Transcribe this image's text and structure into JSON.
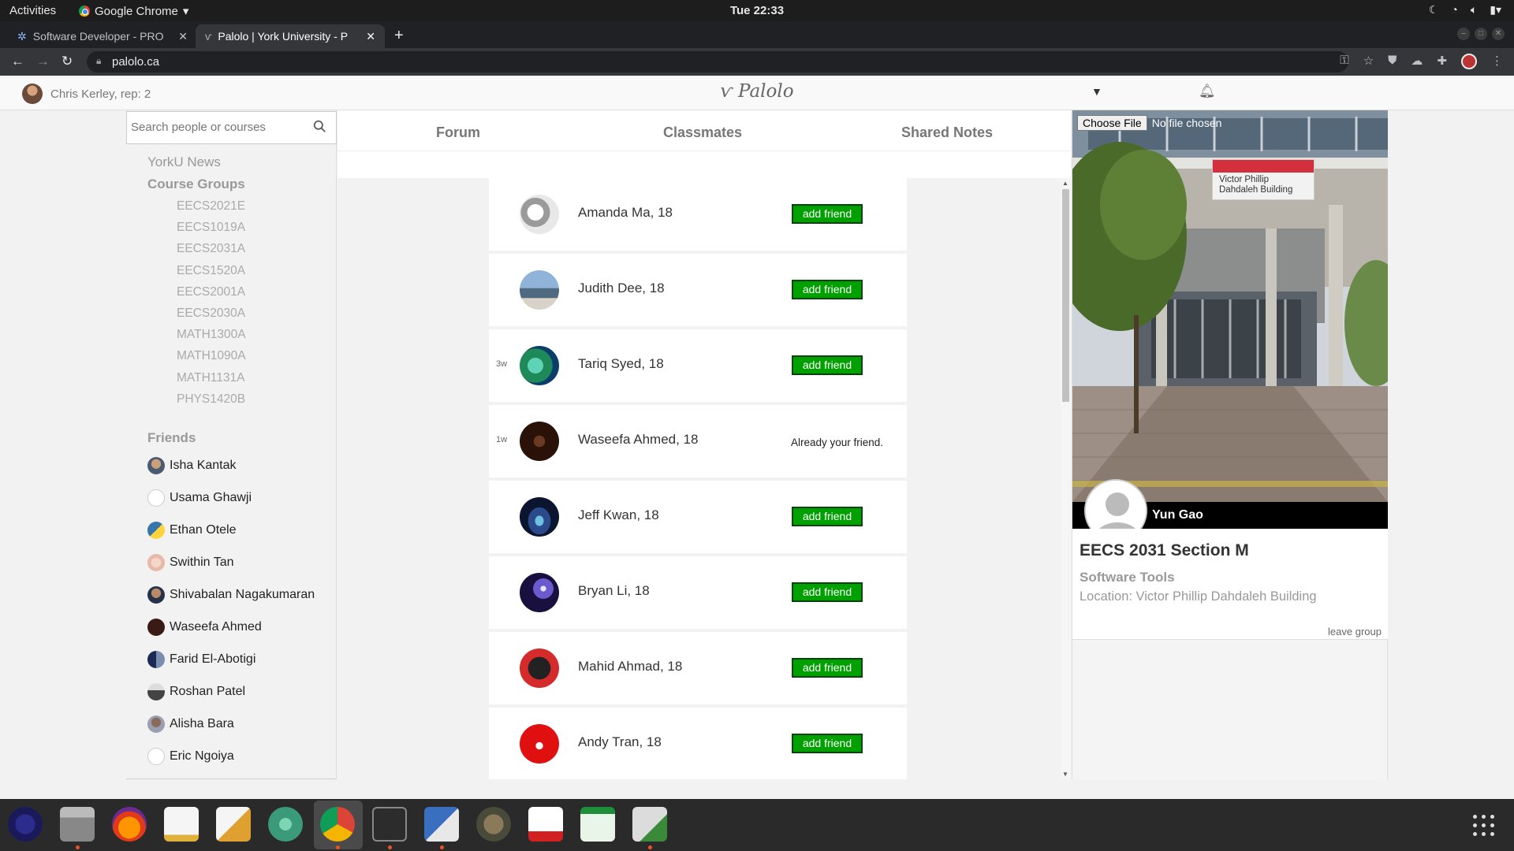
{
  "system": {
    "activities": "Activities",
    "app_name": "Google Chrome",
    "clock": "Tue 22:33"
  },
  "browser": {
    "tabs": [
      {
        "title": "Software Developer - PRO",
        "active": false
      },
      {
        "title": "Palolo | York University - P",
        "active": true
      }
    ],
    "url": "palolo.ca"
  },
  "header": {
    "user": "Chris Kerley, rep: 2",
    "logo": "Palolo"
  },
  "sidebar": {
    "search_placeholder": "Search people or courses",
    "news": "YorkU News",
    "course_groups_heading": "Course Groups",
    "courses": [
      "EECS2021E",
      "EECS1019A",
      "EECS2031A",
      "EECS1520A",
      "EECS2001A",
      "EECS2030A",
      "MATH1300A",
      "MATH1090A",
      "MATH1131A",
      "PHYS1420B"
    ],
    "friends_heading": "Friends",
    "friends": [
      "Isha Kantak",
      "Usama Ghawji",
      "Ethan Otele",
      "Swithin Tan",
      "Shivabalan Nagakumaran",
      "Waseefa Ahmed",
      "Farid El-Abotigi",
      "Roshan Patel",
      "Alisha Bara",
      "Eric Ngoiya"
    ]
  },
  "nav": {
    "forum": "Forum",
    "classmates": "Classmates",
    "shared_notes": "Shared Notes"
  },
  "classmates": [
    {
      "age": "",
      "name": "Amanda Ma, 18",
      "action": "add friend"
    },
    {
      "age": "",
      "name": "Judith Dee, 18",
      "action": "add friend"
    },
    {
      "age": "3w",
      "name": "Tariq Syed, 18",
      "action": "add friend"
    },
    {
      "age": "1w",
      "name": "Waseefa Ahmed, 18",
      "action": "Already your friend."
    },
    {
      "age": "",
      "name": "Jeff Kwan, 18",
      "action": "add friend"
    },
    {
      "age": "",
      "name": "Bryan Li, 18",
      "action": "add friend"
    },
    {
      "age": "",
      "name": "Mahid Ahmad, 18",
      "action": "add friend"
    },
    {
      "age": "",
      "name": "Andy Tran, 18",
      "action": "add friend"
    }
  ],
  "group": {
    "choose_file": "Choose File",
    "no_file": "No file chosen",
    "owner": "Yun Gao",
    "title": "EECS 2031 Section M",
    "subtitle": "Software Tools",
    "location": "Location: Victor Phillip Dahdaleh Building",
    "leave": "leave group",
    "sign_text": "Victor Phillip Dahdaleh Building"
  },
  "colors": {
    "add_friend_green": "#00a000",
    "accent_orange": "#e95420"
  }
}
